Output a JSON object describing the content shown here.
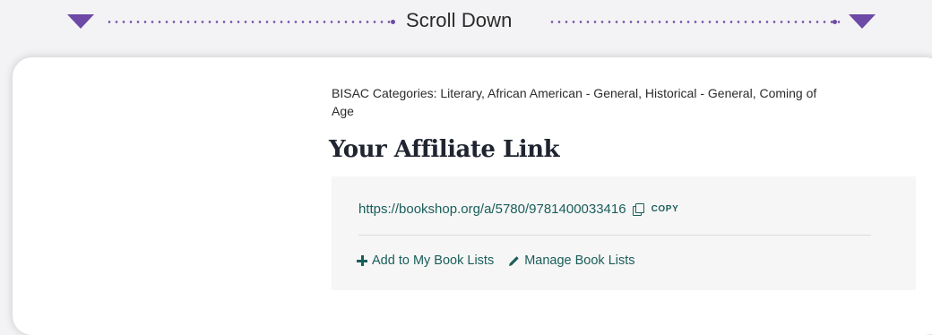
{
  "banner": {
    "label": "Scroll Down",
    "accent": "#6c4aa6"
  },
  "book": {
    "bisac": "BISAC Categories: Literary, African American - General, Historical - General, Coming of Age"
  },
  "affiliate": {
    "heading": "Your Affiliate Link",
    "url": "https://bookshop.org/a/5780/9781400033416",
    "copy_label": "COPY",
    "add_label": "Add to My Book Lists",
    "manage_label": "Manage Book Lists",
    "link_color": "#1a5e5a"
  },
  "icons": [
    "triangle-down-icon",
    "copy-icon",
    "plus-icon",
    "pencil-icon"
  ]
}
